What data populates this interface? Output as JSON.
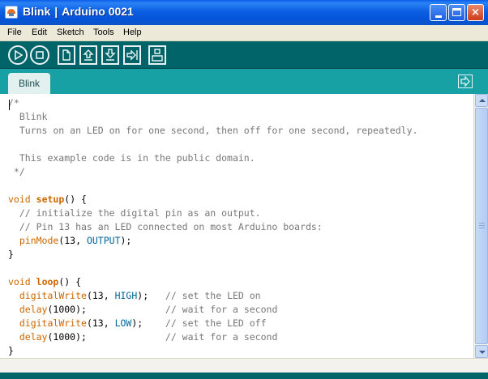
{
  "window": {
    "title_sketch": "Blink",
    "title_separator": "|",
    "title_app": "Arduino 0021",
    "minimize_label": "",
    "maximize_label": "",
    "close_label": "×"
  },
  "menu": {
    "items": [
      {
        "label": "File"
      },
      {
        "label": "Edit"
      },
      {
        "label": "Sketch"
      },
      {
        "label": "Tools"
      },
      {
        "label": "Help"
      }
    ]
  },
  "toolbar": {
    "buttons": [
      {
        "icon": "play-icon",
        "name": "verify"
      },
      {
        "icon": "stop-icon",
        "name": "stop"
      },
      {
        "icon": "new-file-icon",
        "name": "new"
      },
      {
        "icon": "upload-arrow-icon",
        "name": "open"
      },
      {
        "icon": "download-arrow-icon",
        "name": "save"
      },
      {
        "icon": "right-arrow-icon",
        "name": "upload"
      },
      {
        "icon": "serial-monitor-icon",
        "name": "serial-monitor"
      }
    ]
  },
  "tabs": {
    "active": "Blink"
  },
  "colors": {
    "toolbar": "#006468",
    "tabstrip": "#17a1a5",
    "keyword": "#cc6600",
    "constant": "#006699",
    "comment": "#777777"
  },
  "code": {
    "lines": [
      [
        {
          "t": "/*",
          "c": "comment"
        }
      ],
      [
        {
          "t": "  Blink",
          "c": "comment"
        }
      ],
      [
        {
          "t": "  Turns on an LED on for one second, then off for one second, repeatedly.",
          "c": "comment"
        }
      ],
      [],
      [
        {
          "t": "  This example code is in the public domain.",
          "c": "comment"
        }
      ],
      [
        {
          "t": " */",
          "c": "comment"
        }
      ],
      [],
      [
        {
          "t": "void",
          "c": "kw"
        },
        {
          "t": " ",
          "c": "text"
        },
        {
          "t": "setup",
          "c": "fn"
        },
        {
          "t": "() {",
          "c": "text"
        }
      ],
      [
        {
          "t": "  // initialize the digital pin as an output.",
          "c": "comment"
        }
      ],
      [
        {
          "t": "  // Pin 13 has an LED connected on most Arduino boards:",
          "c": "comment"
        }
      ],
      [
        {
          "t": "  ",
          "c": "text"
        },
        {
          "t": "pinMode",
          "c": "call"
        },
        {
          "t": "(13, ",
          "c": "text"
        },
        {
          "t": "OUTPUT",
          "c": "const"
        },
        {
          "t": ");",
          "c": "text"
        }
      ],
      [
        {
          "t": "}",
          "c": "text"
        }
      ],
      [],
      [
        {
          "t": "void",
          "c": "kw"
        },
        {
          "t": " ",
          "c": "text"
        },
        {
          "t": "loop",
          "c": "fn"
        },
        {
          "t": "() {",
          "c": "text"
        }
      ],
      [
        {
          "t": "  ",
          "c": "text"
        },
        {
          "t": "digitalWrite",
          "c": "call"
        },
        {
          "t": "(13, ",
          "c": "text"
        },
        {
          "t": "HIGH",
          "c": "const"
        },
        {
          "t": ");   ",
          "c": "text"
        },
        {
          "t": "// set the LED on",
          "c": "comment"
        }
      ],
      [
        {
          "t": "  ",
          "c": "text"
        },
        {
          "t": "delay",
          "c": "call"
        },
        {
          "t": "(1000);              ",
          "c": "text"
        },
        {
          "t": "// wait for a second",
          "c": "comment"
        }
      ],
      [
        {
          "t": "  ",
          "c": "text"
        },
        {
          "t": "digitalWrite",
          "c": "call"
        },
        {
          "t": "(13, ",
          "c": "text"
        },
        {
          "t": "LOW",
          "c": "const"
        },
        {
          "t": ");    ",
          "c": "text"
        },
        {
          "t": "// set the LED off",
          "c": "comment"
        }
      ],
      [
        {
          "t": "  ",
          "c": "text"
        },
        {
          "t": "delay",
          "c": "call"
        },
        {
          "t": "(1000);              ",
          "c": "text"
        },
        {
          "t": "// wait for a second",
          "c": "comment"
        }
      ],
      [
        {
          "t": "}",
          "c": "text"
        }
      ]
    ]
  }
}
